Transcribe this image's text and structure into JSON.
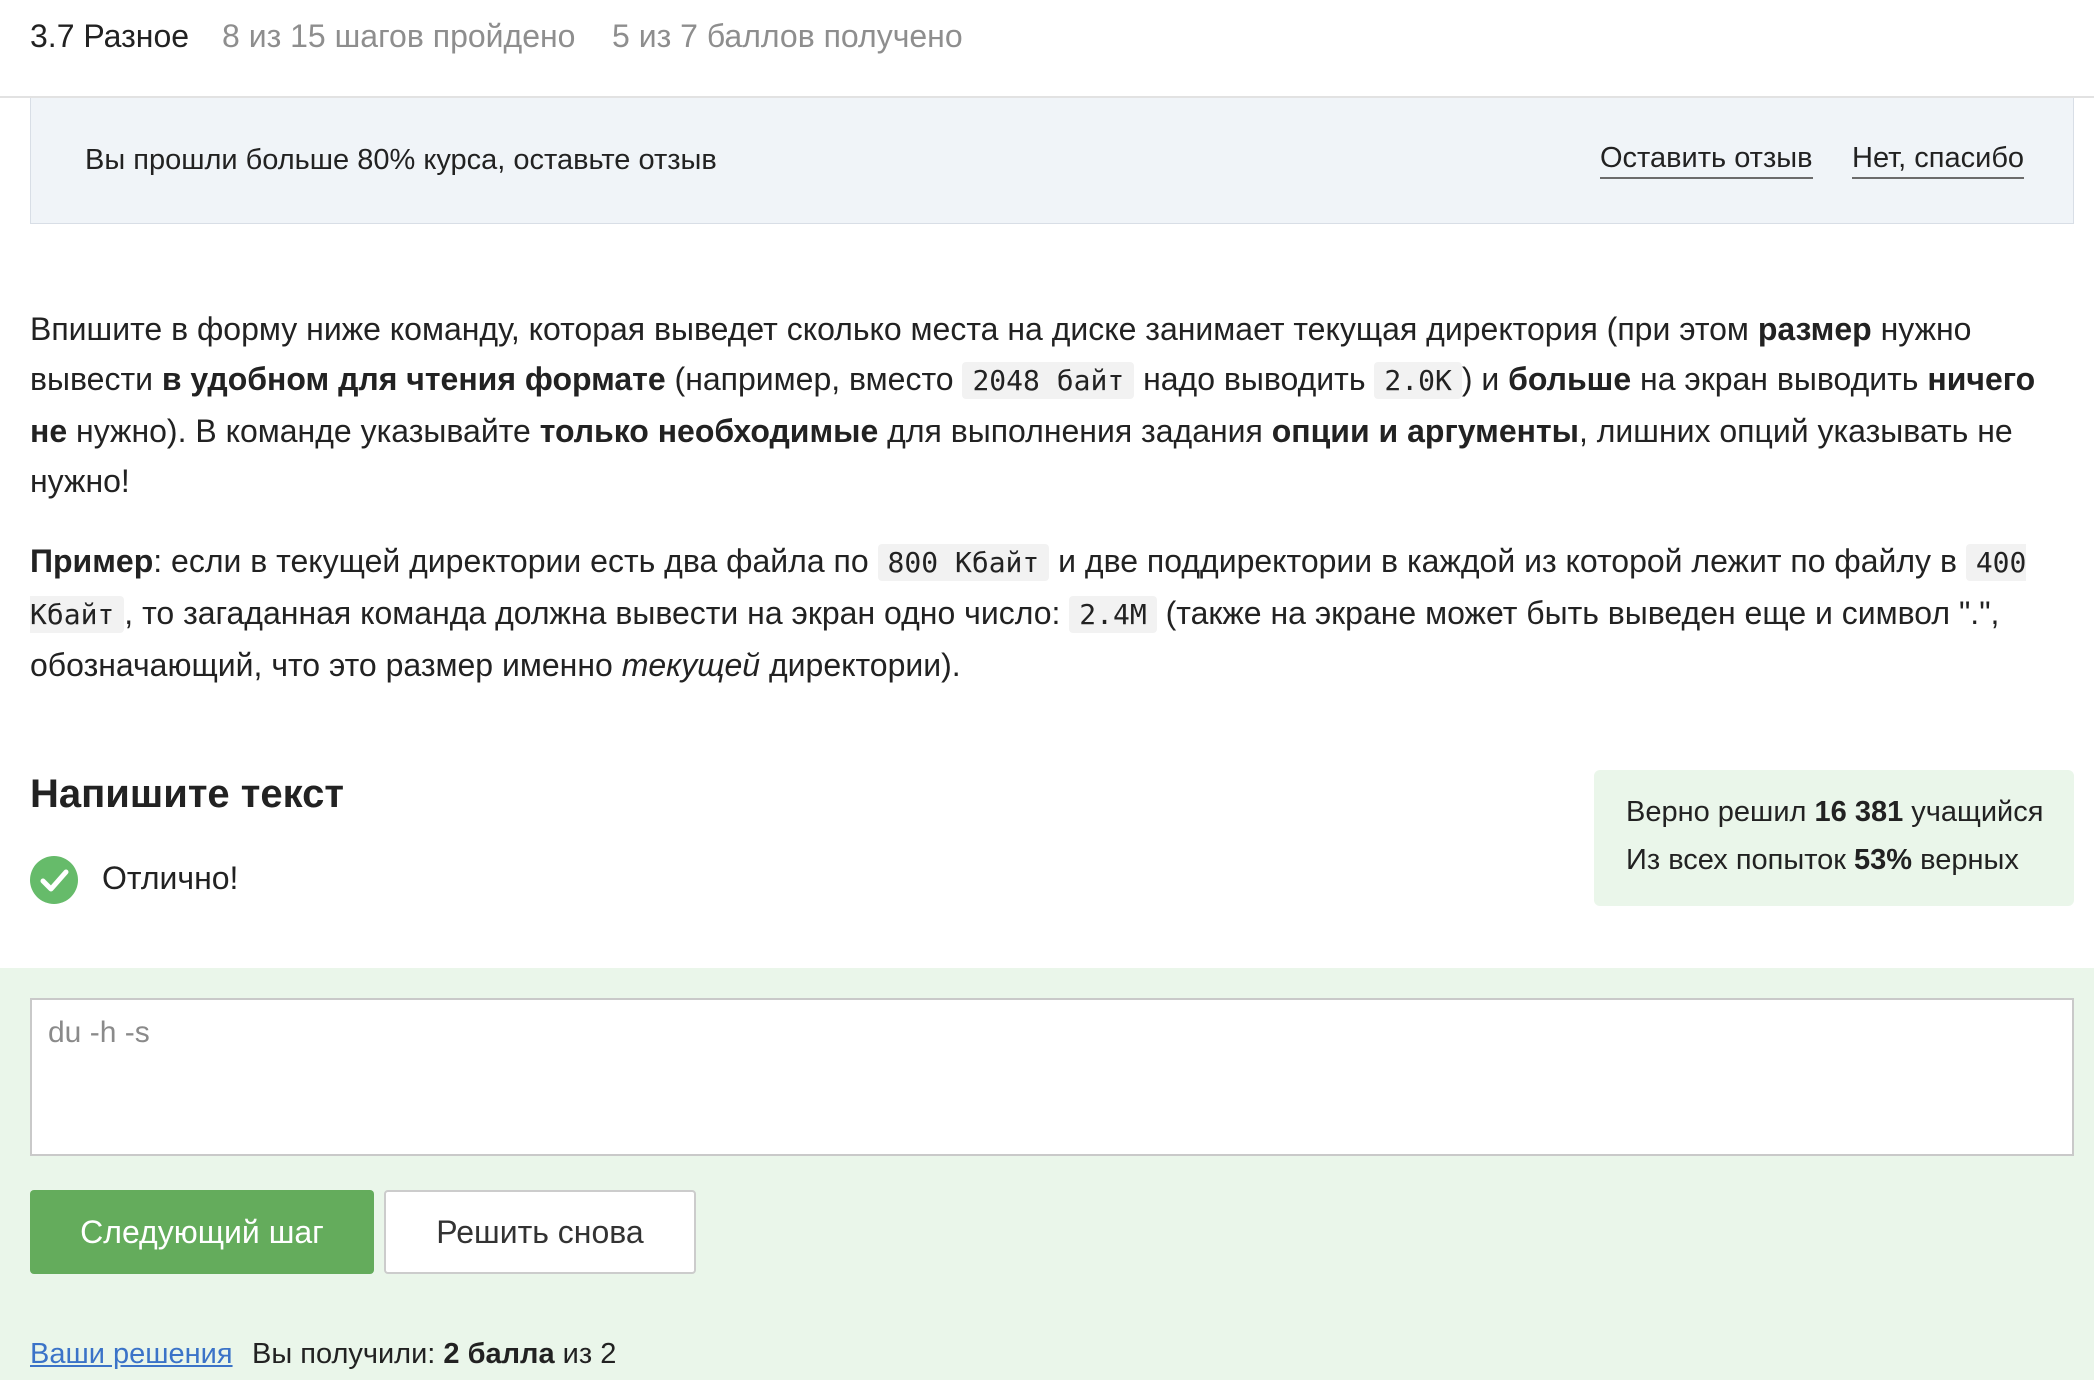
{
  "header": {
    "lesson": "3.7 Разное",
    "steps": "8 из 15 шагов пройдено",
    "points": "5 из 7 баллов  получено"
  },
  "review_banner": {
    "text": "Вы прошли больше 80% курса, оставьте отзыв",
    "leave_label": "Оставить отзыв",
    "decline_label": "Нет, спасибо"
  },
  "task": {
    "p1": {
      "t1": "Впишите в форму ниже команду, которая выведет сколько места на диске занимает текущая директория (при этом ",
      "b1": "размер",
      "t2": " нужно вывести ",
      "b2": "в удобном для чтения формате",
      "t3": " (например, вместо ",
      "c1": "2048 байт",
      "t4": " надо выводить ",
      "c2": "2.0K",
      "t5": ") и ",
      "b3": "больше",
      "t6": " на экран выводить ",
      "b4": "ничего не",
      "t7": " нужно). В команде указывайте ",
      "b5": "только необходимые",
      "t8": " для выполнения задания ",
      "b6": "опции и аргументы",
      "t9": ", лишних опций указывать не нужно!"
    },
    "p2": {
      "b1": "Пример",
      "t1": ": если в текущей директории есть два файла по ",
      "c1": "800 Кбайт",
      "t2": " и две поддиректории в каждой из которой лежит по файлу в ",
      "c2": "400 Кбайт",
      "t3": ", то загаданная команда должна вывести на экран одно число: ",
      "c3": "2.4M",
      "t4": " (также на экране может быть выведен еще и символ \".\", обозначающий, что это размер именно ",
      "i1": "текущей",
      "t5": " директории)."
    }
  },
  "answer_section": {
    "title": "Напишите текст",
    "status_text": "Отлично!",
    "status_color": "#66bb6a",
    "input_value": "du -h -s"
  },
  "stats": {
    "line1_prefix": "Верно решил ",
    "line1_count": "16 381",
    "line1_suffix": " учащийся",
    "line2_prefix": "Из всех попыток ",
    "line2_percent": "53%",
    "line2_suffix": " верных"
  },
  "buttons": {
    "next": "Следующий шаг",
    "retry": "Решить снова"
  },
  "footer": {
    "solutions_link": "Ваши решения",
    "score_prefix": "Вы получили: ",
    "score_bold": "2 балла",
    "score_suffix": " из 2"
  }
}
